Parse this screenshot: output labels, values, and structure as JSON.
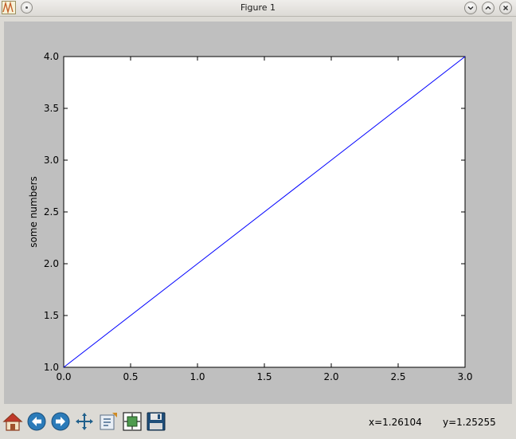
{
  "window": {
    "title": "Figure 1"
  },
  "toolbar": {
    "buttons": [
      "home-icon",
      "back-arrow-icon",
      "forward-arrow-icon",
      "pan-move-icon",
      "zoom-rect-icon",
      "configure-subplots-icon",
      "save-floppy-icon"
    ],
    "coord_x": "x=1.26104",
    "coord_y": "y=1.25255"
  },
  "chart_data": {
    "type": "line",
    "title": "",
    "xlabel": "",
    "ylabel": "some numbers",
    "xlim": [
      0.0,
      3.0
    ],
    "ylim": [
      1.0,
      4.0
    ],
    "x": [
      0,
      1,
      2,
      3
    ],
    "series": [
      {
        "values": [
          1,
          2,
          3,
          4
        ],
        "color": "#0000ff"
      }
    ],
    "xticks": [
      "0.0",
      "0.5",
      "1.0",
      "1.5",
      "2.0",
      "2.5",
      "3.0"
    ],
    "yticks": [
      "1.0",
      "1.5",
      "2.0",
      "2.5",
      "3.0",
      "3.5",
      "4.0"
    ],
    "grid": false
  },
  "colors": {
    "canvas_bg": "#bfbfbf",
    "axes_bg": "#ffffff",
    "line": "#0000ff"
  }
}
